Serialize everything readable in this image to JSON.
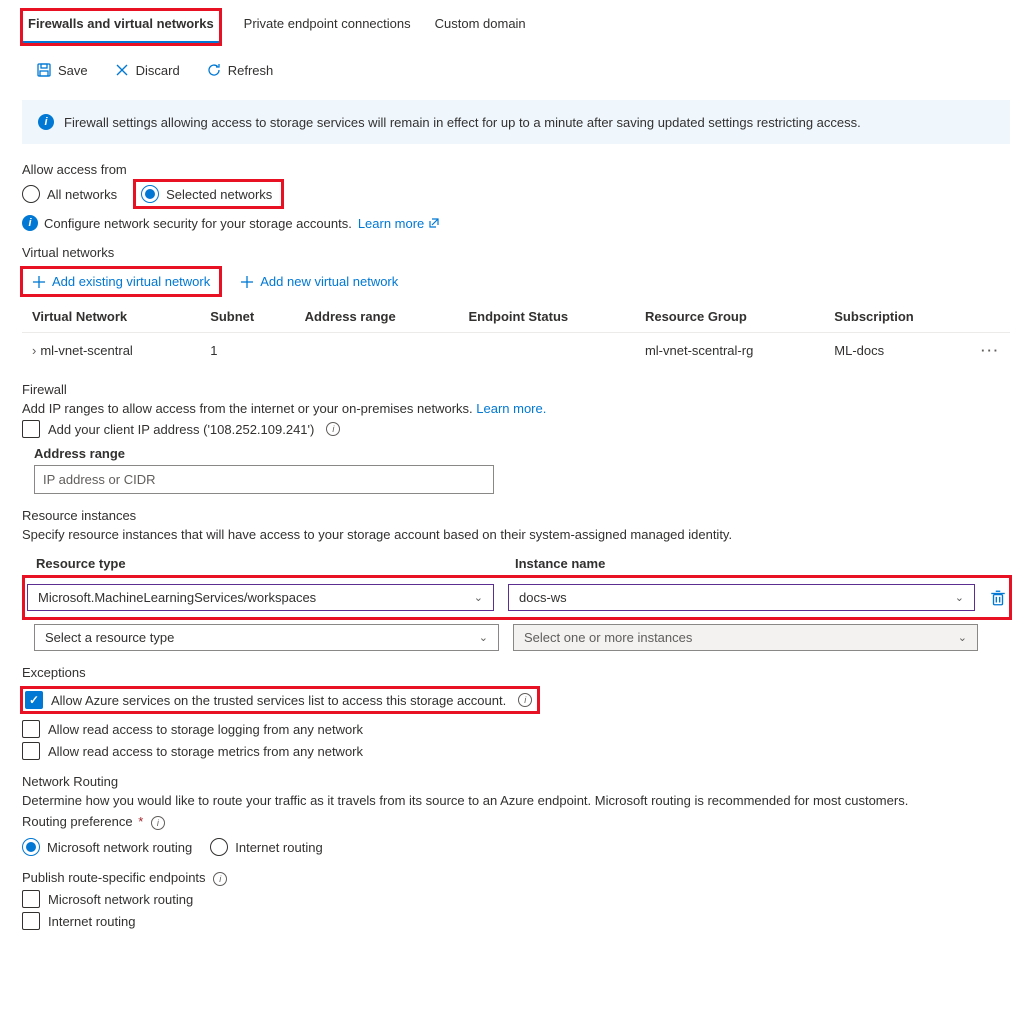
{
  "tabs": {
    "firewalls": "Firewalls and virtual networks",
    "private_endpoints": "Private endpoint connections",
    "custom_domain": "Custom domain"
  },
  "toolbar": {
    "save": "Save",
    "discard": "Discard",
    "refresh": "Refresh"
  },
  "info_banner": "Firewall settings allowing access to storage services will remain in effect for up to a minute after saving updated settings restricting access.",
  "access": {
    "label": "Allow access from",
    "all": "All networks",
    "selected": "Selected networks",
    "helper": "Configure network security for your storage accounts.",
    "learn_more": "Learn more"
  },
  "vnets": {
    "title": "Virtual networks",
    "add_existing": "Add existing virtual network",
    "add_new": "Add new virtual network",
    "cols": {
      "vnet": "Virtual Network",
      "subnet": "Subnet",
      "range": "Address range",
      "endpoint": "Endpoint Status",
      "rg": "Resource Group",
      "sub": "Subscription"
    },
    "row": {
      "vnet": "ml-vnet-scentral",
      "subnet": "1",
      "range": "",
      "endpoint": "",
      "rg": "ml-vnet-scentral-rg",
      "sub": "ML-docs"
    }
  },
  "firewall": {
    "title": "Firewall",
    "desc": "Add IP ranges to allow access from the internet or your on-premises networks.",
    "learn_more": "Learn more.",
    "add_client_ip": "Add your client IP address ('108.252.109.241')",
    "address_range_label": "Address range",
    "placeholder": "IP address or CIDR"
  },
  "resource_instances": {
    "title": "Resource instances",
    "desc": "Specify resource instances that will have access to your storage account based on their system-assigned managed identity.",
    "col_type": "Resource type",
    "col_instance": "Instance name",
    "row1_type": "Microsoft.MachineLearningServices/workspaces",
    "row1_instance": "docs-ws",
    "row2_type_placeholder": "Select a resource type",
    "row2_instance_placeholder": "Select one or more instances"
  },
  "exceptions": {
    "title": "Exceptions",
    "allow_trusted": "Allow Azure services on the trusted services list to access this storage account.",
    "allow_logging": "Allow read access to storage logging from any network",
    "allow_metrics": "Allow read access to storage metrics from any network"
  },
  "routing": {
    "title": "Network Routing",
    "desc": "Determine how you would like to route your traffic as it travels from its source to an Azure endpoint. Microsoft routing is recommended for most customers.",
    "pref_label": "Routing preference",
    "microsoft": "Microsoft network routing",
    "internet": "Internet routing",
    "publish_label": "Publish route-specific endpoints",
    "publish_ms": "Microsoft network routing",
    "publish_internet": "Internet routing"
  }
}
